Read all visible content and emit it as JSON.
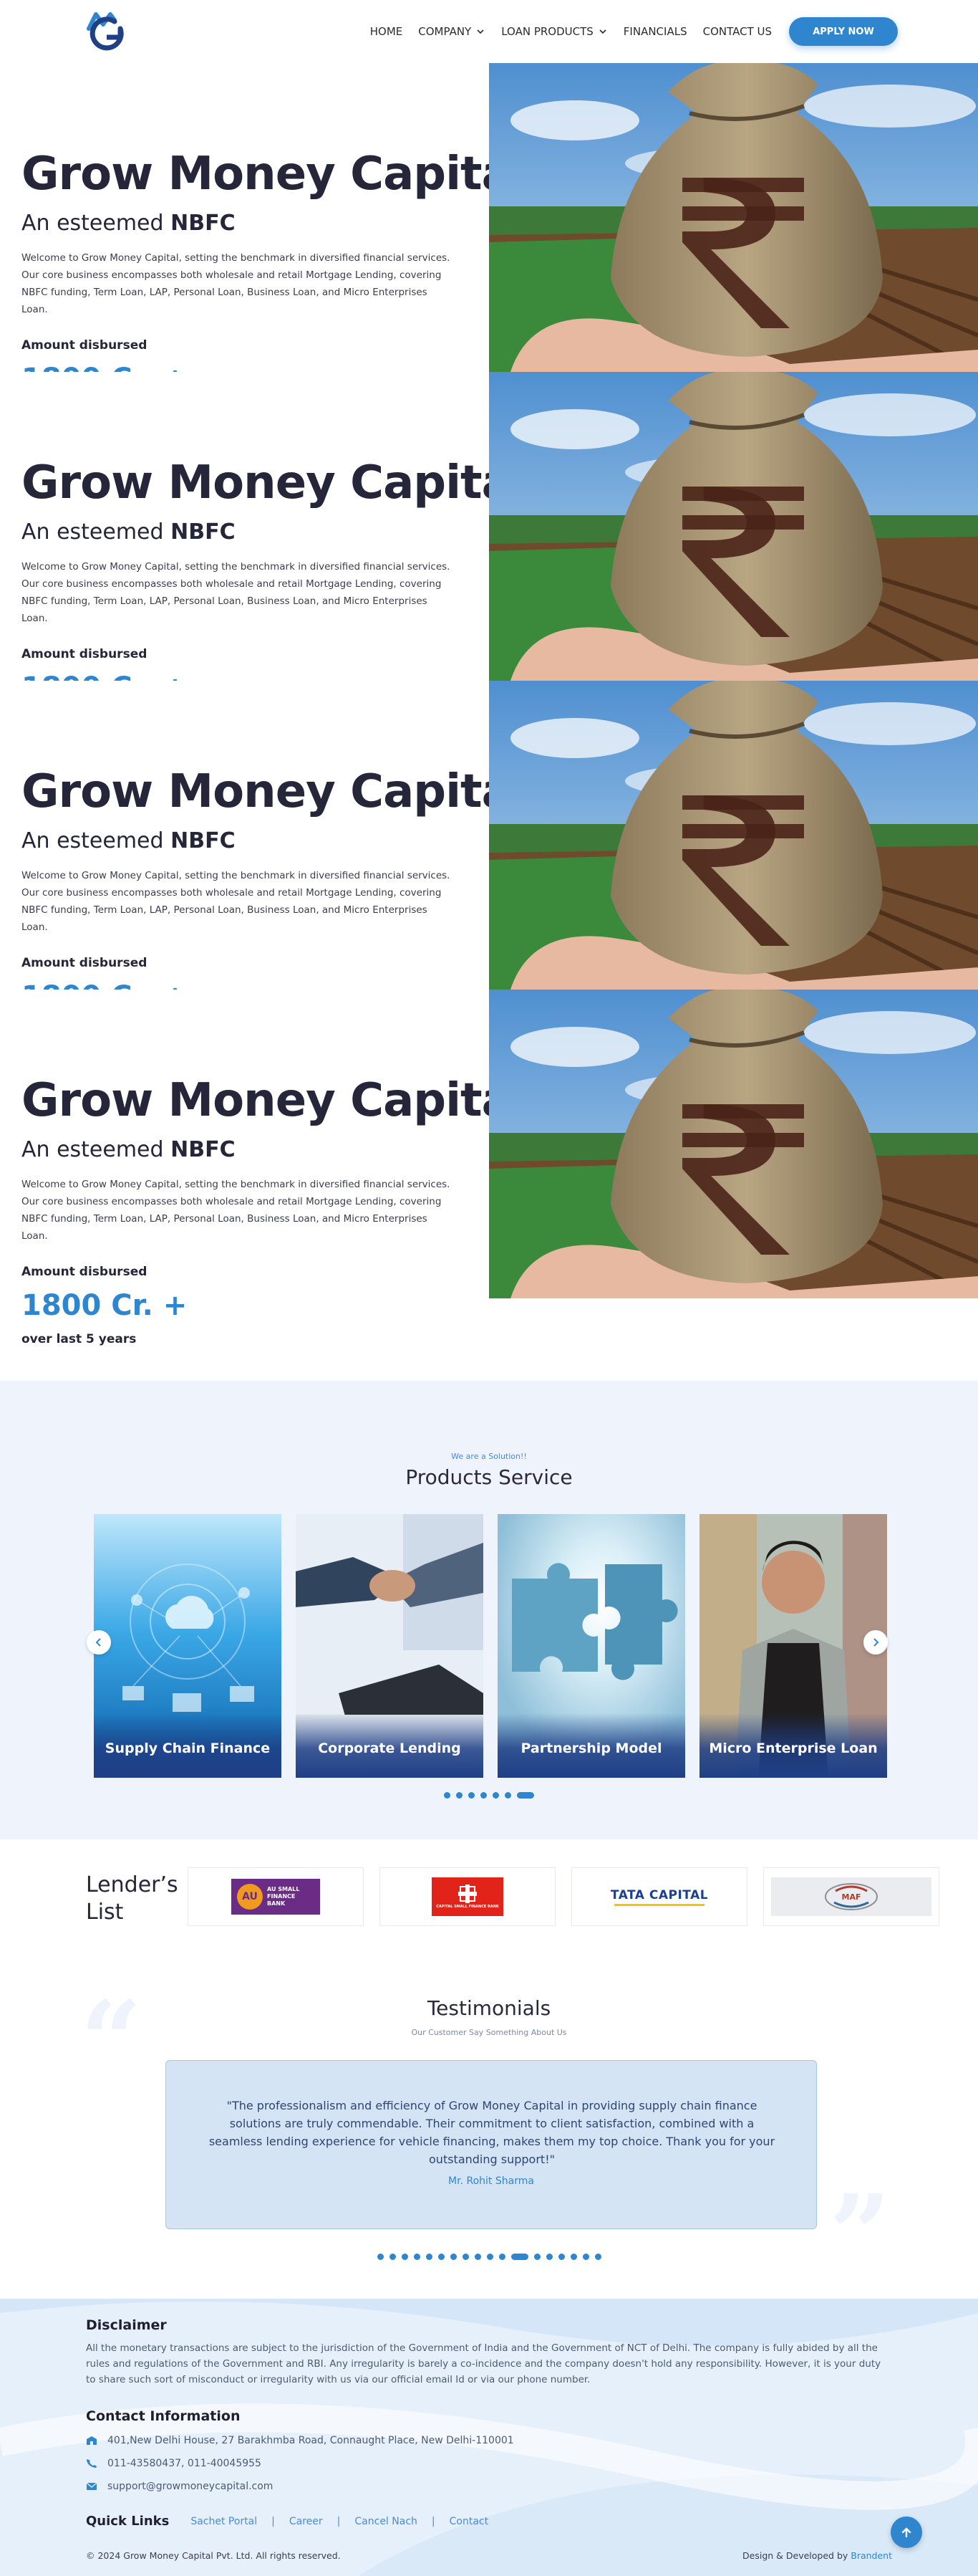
{
  "nav": {
    "items": [
      {
        "label": "HOME",
        "dropdown": false
      },
      {
        "label": "COMPANY",
        "dropdown": true
      },
      {
        "label": "LOAN PRODUCTS",
        "dropdown": true
      },
      {
        "label": "FINANCIALS",
        "dropdown": false
      },
      {
        "label": "CONTACT US",
        "dropdown": false
      }
    ],
    "apply_label": "APPLY NOW"
  },
  "hero": {
    "title": "Grow Money Capital",
    "subtitle_prefix": "An esteemed ",
    "subtitle_bold": "NBFC",
    "description": "Welcome to Grow Money Capital, setting the benchmark in diversified financial services. Our core business encompasses both wholesale and retail Mortgage Lending, covering NBFC funding, Term Loan, LAP, Personal Loan, Business Loan, and Micro Enterprises Loan.",
    "amount_label": "Amount disbursed",
    "amount_value": "1800 Cr. +",
    "amount_footnote": "over last 5 years",
    "slides": 4
  },
  "products": {
    "eyebrow": "We are a Solution!!",
    "title": "Products Service",
    "cards": [
      {
        "label": "Supply Chain Finance",
        "icon": "cloud-network-image"
      },
      {
        "label": "Corporate Lending",
        "icon": "handshake-image"
      },
      {
        "label": "Partnership Model",
        "icon": "puzzle-image"
      },
      {
        "label": "Micro Enterprise Loan",
        "icon": "shopkeeper-image"
      }
    ],
    "dots": 7,
    "active_dot": 6
  },
  "lenders": {
    "title_line1": "Lender’s",
    "title_line2": "List",
    "logos": [
      {
        "name": "au-small-finance-bank-logo",
        "text1": "AU",
        "text2": "AU SMALL FINANCE BANK",
        "color": "#6b2c85"
      },
      {
        "name": "capital-small-finance-bank-logo",
        "text1": "CAPITAL SMALL FINANCE BANK",
        "color": "#e2231a"
      },
      {
        "name": "tata-capital-logo",
        "text1": "TATA CAPITAL",
        "color": "#1b3f95"
      },
      {
        "name": "maf-logo",
        "text1": "MAF",
        "color": "#b23a2e"
      }
    ]
  },
  "testimonials": {
    "title": "Testimonials",
    "subtitle": "Our Customer Say Something About Us",
    "quote": "\"The professionalism and efficiency of Grow Money Capital in providing supply chain finance solutions are truly commendable. Their commitment to client satisfaction, combined with a seamless lending experience for vehicle financing, makes them my top choice. Thank you for your outstanding support!\"",
    "author": "Mr. Rohit Sharma",
    "dots": 18,
    "active_dot": 11
  },
  "footer": {
    "disclaimer_title": "Disclaimer",
    "disclaimer_text": "All the monetary transactions are subject to the jurisdiction of the Government of India and the Government of NCT of Delhi. The company is fully abided by all the rules and regulations of the Government and RBI. Any irregularity is barely a co-incidence and the company doesn't hold any responsibility. However, it is your duty to share such sort of misconduct or irregularity with us via our official email Id or via our phone number.",
    "contact_title": "Contact Information",
    "address": "401,New Delhi House, 27 Barakhmba Road, Connaught Place, New Delhi-110001",
    "phone": "011-43580437, 011-40045955",
    "email": "support@growmoneycapital.com",
    "quick_links_title": "Quick Links",
    "quick_links": [
      "Sachet Portal",
      "Career",
      "Cancel Nach",
      "Contact"
    ],
    "copyright": "© 2024 Grow Money Capital Pvt. Ltd. All rights reserved.",
    "credit_prefix": "Design & Developed by ",
    "credit_name": "Brandent"
  },
  "colors": {
    "accent": "#2f86cf",
    "heading": "#26263a",
    "products_bg": "#eef3fc",
    "footer_bg": "#e6f0fb"
  }
}
